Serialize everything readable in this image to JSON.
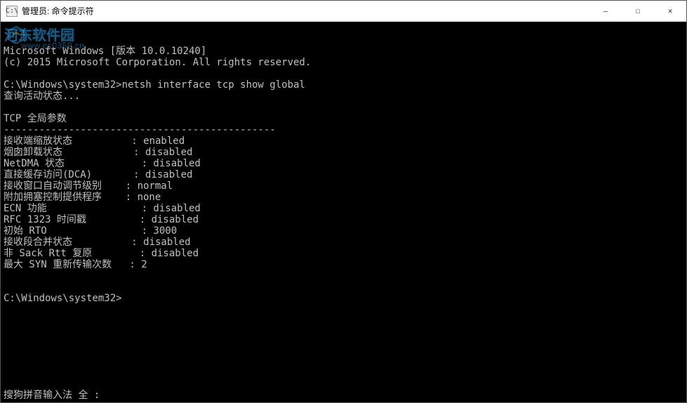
{
  "titlebar": {
    "icon_label": "C:\\",
    "title": "管理员: 命令提示符"
  },
  "window_controls": {
    "minimize": "—",
    "maximize": "☐",
    "close": "✕"
  },
  "watermark": {
    "logo_text": "河东软件园",
    "sub_text": "www.pc0359.cn"
  },
  "terminal": {
    "lines": [
      "Microsoft Windows [版本 10.0.10240]",
      "(c) 2015 Microsoft Corporation. All rights reserved.",
      "",
      "C:\\Windows\\system32>netsh interface tcp show global",
      "查询活动状态...",
      "",
      "TCP 全局参数",
      "----------------------------------------------",
      "接收端缩放状态          : enabled",
      "烟囱卸载状态            : disabled",
      "NetDMA 状态             : disabled",
      "直接缓存访问(DCA)       : disabled",
      "接收窗口自动调节级别    : normal",
      "附加拥塞控制提供程序    : none",
      "ECN 功能                : disabled",
      "RFC 1323 时间戳         : disabled",
      "初始 RTO                : 3000",
      "接收段合并状态          : disabled",
      "非 Sack Rtt 复原        : disabled",
      "最大 SYN 重新传输次数   : 2",
      "",
      "",
      "C:\\Windows\\system32>"
    ],
    "prompt_cursor": true
  },
  "ime": {
    "status": "搜狗拼音输入法 全 :"
  }
}
